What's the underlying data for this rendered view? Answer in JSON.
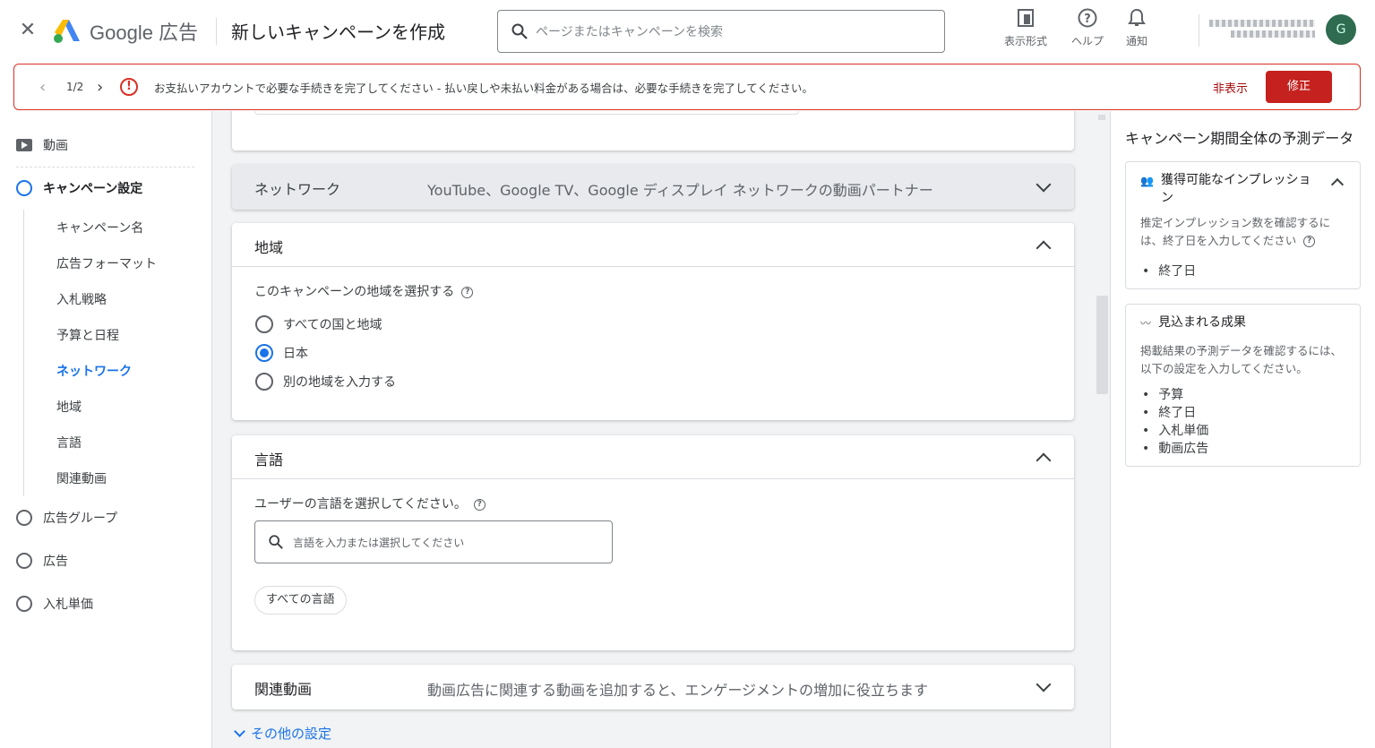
{
  "header": {
    "close_icon": "close-icon",
    "logo_brand": "Google",
    "logo_product": "広告",
    "page_title": "新しいキャンペーンを作成",
    "search_placeholder": "ページまたはキャンペーンを検索",
    "view_label": "表示形式",
    "help_label": "ヘルプ",
    "notif_label": "通知"
  },
  "banner": {
    "count": "1/2",
    "message": "お支払いアカウントで必要な手続きを完了してください - 払い戻しや未払い料金がある場合は、必要な手続きを完了してください。",
    "hide_label": "非表示",
    "fix_label": "修正",
    "colors": {
      "border": "#d93025",
      "button": "#c5221f"
    }
  },
  "sidebar": {
    "video_label": "動画",
    "campaign_settings": "キャンペーン設定",
    "sub_items": [
      "キャンペーン名",
      "広告フォーマット",
      "入札戦略",
      "予算と日程",
      "ネットワーク",
      "地域",
      "言語",
      "関連動画"
    ],
    "active_sub": "ネットワーク",
    "ad_group": "広告グループ",
    "ad": "広告",
    "bid": "入札単価"
  },
  "main": {
    "network": {
      "title": "ネットワーク",
      "summary": "YouTube、Google TV、Google ディスプレイ ネットワークの動画パートナー"
    },
    "region": {
      "title": "地域",
      "question": "このキャンペーンの地域を選択する",
      "options": [
        "すべての国と地域",
        "日本",
        "別の地域を入力する"
      ],
      "selected": "日本"
    },
    "language": {
      "title": "言語",
      "question": "ユーザーの言語を選択してください。",
      "input_placeholder": "言語を入力または選択してください",
      "chip": "すべての言語"
    },
    "related": {
      "title": "関連動画",
      "summary": "動画広告に関連する動画を追加すると、エンゲージメントの増加に役立ちます"
    },
    "more_settings": "その他の設定"
  },
  "right_panel": {
    "title": "キャンペーン期間全体の予測データ",
    "impressions": {
      "title": "獲得可能なインプレッション",
      "desc": "推定インプレッション数を確認するには、終了日を入力してください",
      "items": [
        "終了日"
      ]
    },
    "results": {
      "title": "見込まれる成果",
      "desc": "掲載結果の予測データを確認するには、以下の設定を入力してください。",
      "items": [
        "予算",
        "終了日",
        "入札単価",
        "動画広告"
      ]
    }
  },
  "accent_color": "#1a73e8"
}
